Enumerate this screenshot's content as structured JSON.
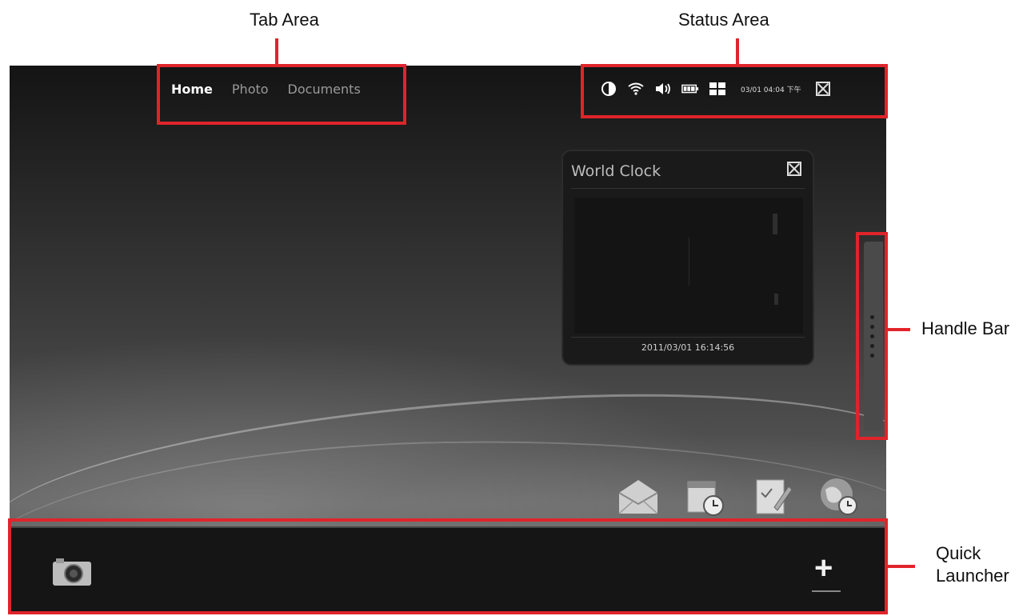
{
  "callouts": {
    "tab_area": "Tab Area",
    "status_area": "Status Area",
    "handle_bar": "Handle Bar",
    "quick_launcher_line1": "Quick",
    "quick_launcher_line2": "Launcher"
  },
  "tabs": [
    {
      "label": "Home",
      "active": true
    },
    {
      "label": "Photo",
      "active": false
    },
    {
      "label": "Documents",
      "active": false
    }
  ],
  "status": {
    "icons": [
      "contrast-icon",
      "wifi-icon",
      "volume-icon",
      "battery-icon",
      "grid-icon",
      "close-icon"
    ],
    "datetime": "03/01 04:04 下午"
  },
  "world_clock": {
    "title": "World Clock",
    "timestamp": "2011/03/01 16:14:56"
  },
  "app_icons": [
    "mail-icon",
    "calendar-clock-icon",
    "notes-icon",
    "world-clock-icon"
  ],
  "quick_launcher": {
    "items": [
      "camera-icon"
    ],
    "add_label": "+"
  },
  "colors": {
    "annotation": "#e0242a",
    "launcher_bg": "#151515"
  }
}
